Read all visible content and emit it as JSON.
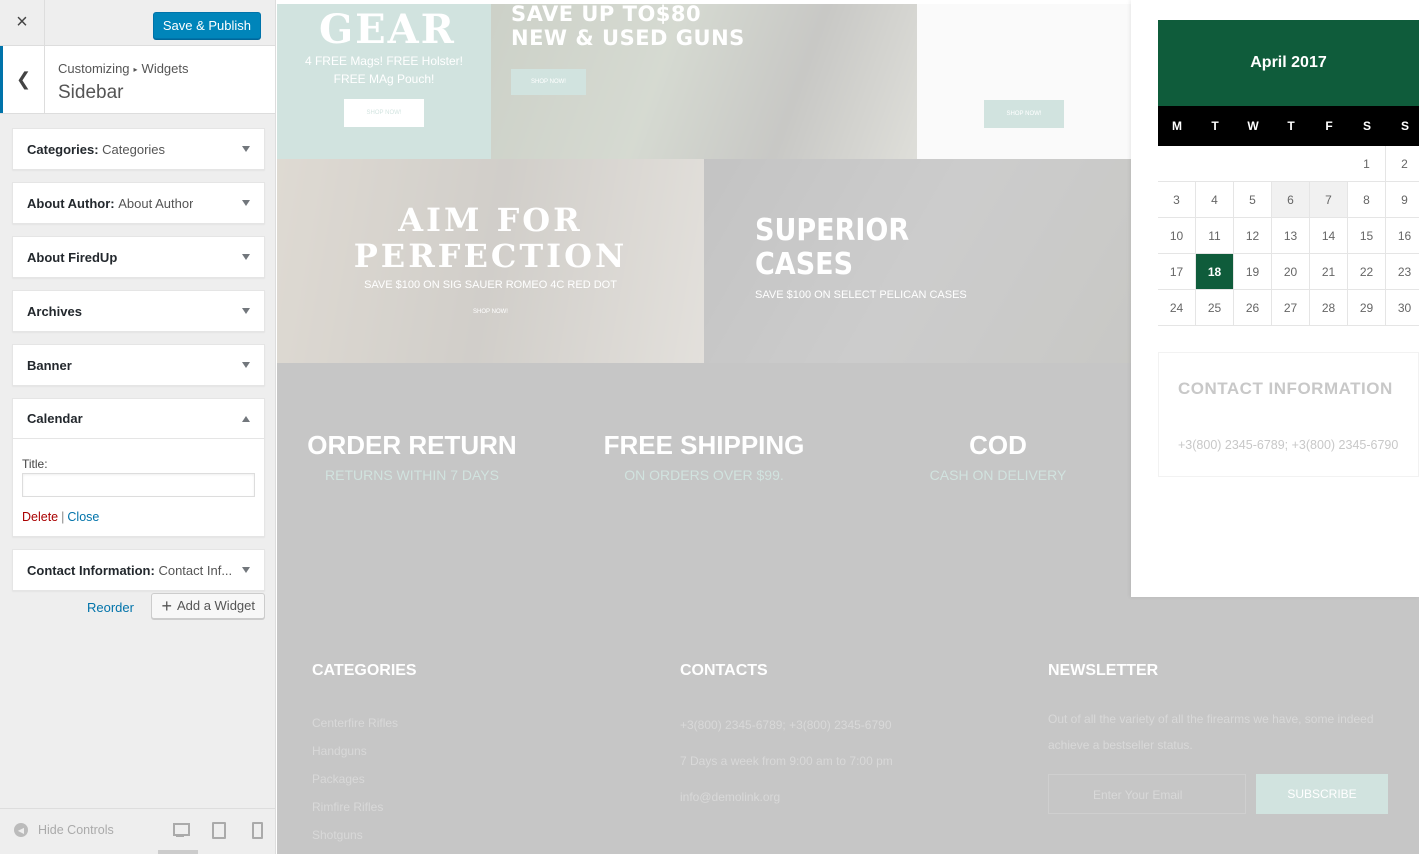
{
  "topbar": {
    "close_icon": "×",
    "publish_label": "Save & Publish"
  },
  "section": {
    "breadcrumb_root": "Customizing",
    "breadcrumb_sep": "▸",
    "breadcrumb_leaf": "Widgets",
    "title": "Sidebar"
  },
  "widgets": [
    {
      "title": "Categories:",
      "subtitle": "Categories",
      "expanded": false
    },
    {
      "title": "About Author:",
      "subtitle": "About Author",
      "expanded": false
    },
    {
      "title": "About FiredUp",
      "subtitle": "",
      "expanded": false
    },
    {
      "title": "Archives",
      "subtitle": "",
      "expanded": false
    },
    {
      "title": "Banner",
      "subtitle": "",
      "expanded": false
    },
    {
      "title": "Calendar",
      "subtitle": "",
      "expanded": true,
      "form": {
        "title_label": "Title:",
        "title_value": "",
        "delete_label": "Delete",
        "separator": "|",
        "close_label": "Close"
      }
    },
    {
      "title": "Contact Information:",
      "subtitle": "Contact Inf...",
      "expanded": false
    }
  ],
  "reorder_label": "Reorder",
  "add_widget_label": "Add a Widget",
  "hide_controls_label": "Hide Controls",
  "preview": {
    "gear": {
      "headline": "GEAR",
      "line1": "4 FREE Mags! FREE Holster!",
      "line2": "FREE MAg Pouch!",
      "button": "SHOP NOW!"
    },
    "guns": {
      "line1": "SAVE UP TO$80",
      "line2": "NEW & USED GUNS",
      "button": "SHOP NOW!"
    },
    "pistol": {
      "button": "SHOP NOW!"
    },
    "aim": {
      "line1": "AIM FOR",
      "line2": "PERFECTION",
      "sub": "SAVE $100 ON SIG SAUER ROMEO 4C RED DOT",
      "button": "SHOP NOW!"
    },
    "cases": {
      "line1": "SUPERIOR",
      "line2": "CASES",
      "sub": "SAVE $100 ON SELECT PELICAN CASES"
    },
    "features": [
      {
        "title": "ORDER RETURN",
        "sub": "RETURNS WITHIN 7 DAYS"
      },
      {
        "title": "FREE SHIPPING",
        "sub": "ON ORDERS OVER $99."
      },
      {
        "title": "COD",
        "sub": "CASH ON DELIVERY"
      }
    ],
    "footer": {
      "categories": {
        "title": "CATEGORIES",
        "items": [
          "Centerfire Rifles",
          "Handguns",
          "Packages",
          "Rimfire Rifles",
          "Shotguns"
        ]
      },
      "contacts": {
        "title": "CONTACTS",
        "phone": "+3(800) 2345-6789; +3(800) 2345-6790",
        "hours": "7 Days a week from 9:00 am to 7:00 pm",
        "email": "info@demolink.org"
      },
      "newsletter": {
        "title": "NEWSLETTER",
        "text1": "Out of all the variety of all the firearms we have, some indeed",
        "text2": "achieve a bestseller status.",
        "placeholder": "Enter Your Email",
        "button": "SUBSCRIBE"
      }
    }
  },
  "calendar": {
    "month": "April 2017",
    "weekdays": [
      "M",
      "T",
      "W",
      "T",
      "F",
      "S",
      "S"
    ],
    "leading_blanks": 5,
    "days": 30,
    "today": 18,
    "shaded": [
      6,
      7
    ],
    "accent_color": "#0f5c3b"
  },
  "contact_widget": {
    "title": "CONTACT INFORMATION",
    "phones": "+3(800) 2345-6789; +3(800) 2345-6790"
  }
}
